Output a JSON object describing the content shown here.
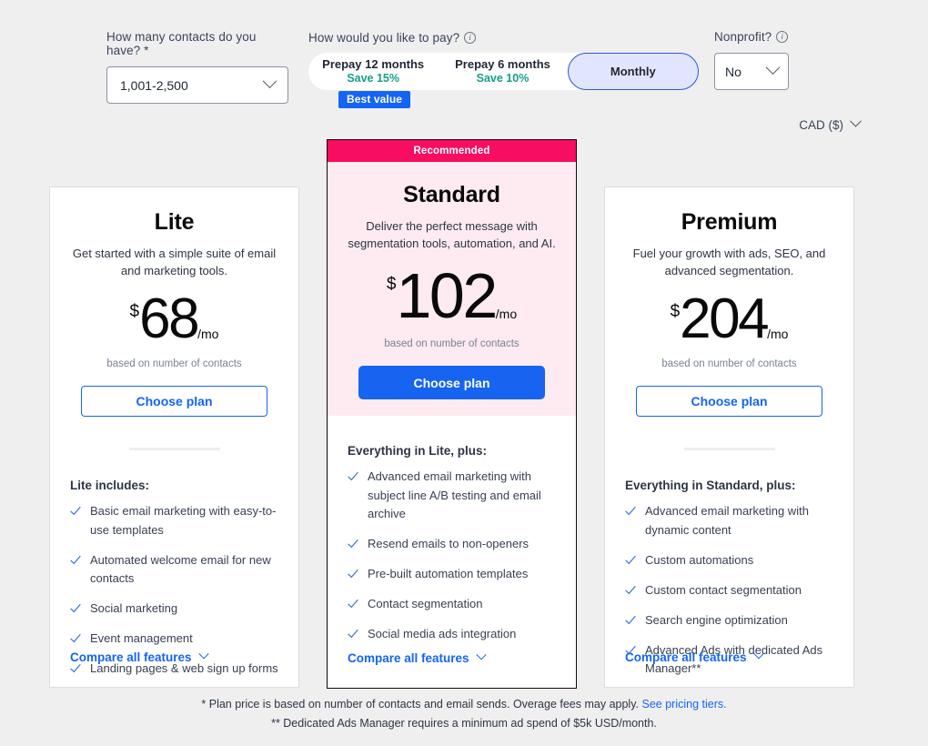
{
  "controls": {
    "contacts": {
      "label": "How many contacts do you have? *",
      "value": "1,001-2,500"
    },
    "pay": {
      "label": "How would you like to pay?",
      "info_icon": "info-icon",
      "options": [
        {
          "title": "Prepay 12 months",
          "sub": "Save 15%",
          "active": false,
          "badge": "Best value"
        },
        {
          "title": "Prepay 6 months",
          "sub": "Save 10%",
          "active": false,
          "badge": ""
        },
        {
          "title": "Monthly",
          "sub": "",
          "active": true,
          "badge": ""
        }
      ]
    },
    "nonprofit": {
      "label": "Nonprofit?",
      "info_icon": "info-icon",
      "value": "No"
    },
    "currency": {
      "value": "CAD ($)"
    }
  },
  "plans": [
    {
      "id": "lite",
      "name": "Lite",
      "description": "Get started with a simple suite of email and marketing tools.",
      "currency_symbol": "$",
      "price": "68",
      "period": "/mo",
      "price_note": "based on number of contacts",
      "cta": "Choose plan",
      "features_head": "Lite includes:",
      "features": [
        "Basic email marketing with easy-to-use templates",
        "Automated welcome email for new contacts",
        "Social marketing",
        "Event management",
        "Landing pages & web sign up forms"
      ],
      "compare": "Compare all features"
    },
    {
      "id": "standard",
      "badge": "Recommended",
      "name": "Standard",
      "description": "Deliver the perfect message with segmentation tools, automation, and AI.",
      "currency_symbol": "$",
      "price": "102",
      "period": "/mo",
      "price_note": "based on number of contacts",
      "cta": "Choose plan",
      "features_head": "Everything in Lite, plus:",
      "features": [
        "Advanced email marketing with subject line A/B testing and email archive",
        "Resend emails to non-openers",
        "Pre-built automation templates",
        "Contact segmentation",
        "Social media ads integration"
      ],
      "compare": "Compare all features"
    },
    {
      "id": "premium",
      "name": "Premium",
      "description": "Fuel your growth with ads, SEO, and advanced segmentation.",
      "currency_symbol": "$",
      "price": "204",
      "period": "/mo",
      "price_note": "based on number of contacts",
      "cta": "Choose plan",
      "features_head": "Everything in Standard, plus:",
      "features": [
        "Advanced email marketing with dynamic content",
        "Custom automations",
        "Custom contact segmentation",
        "Search engine optimization",
        "Advanced Ads with dedicated Ads Manager**"
      ],
      "compare": "Compare all features"
    }
  ],
  "footnotes": {
    "line1": "* Plan price is based on number of contacts and email sends. Overage fees may apply.",
    "line1_link": "See pricing tiers.",
    "line2": "** Dedicated Ads Manager requires a minimum ad spend of $5k USD/month."
  },
  "colors": {
    "accent_blue": "#1464f6",
    "recommended_pink": "#f70d62",
    "card_pink_bg": "#fdebf1",
    "save_green": "#16a085",
    "page_bg": "#efefef"
  }
}
